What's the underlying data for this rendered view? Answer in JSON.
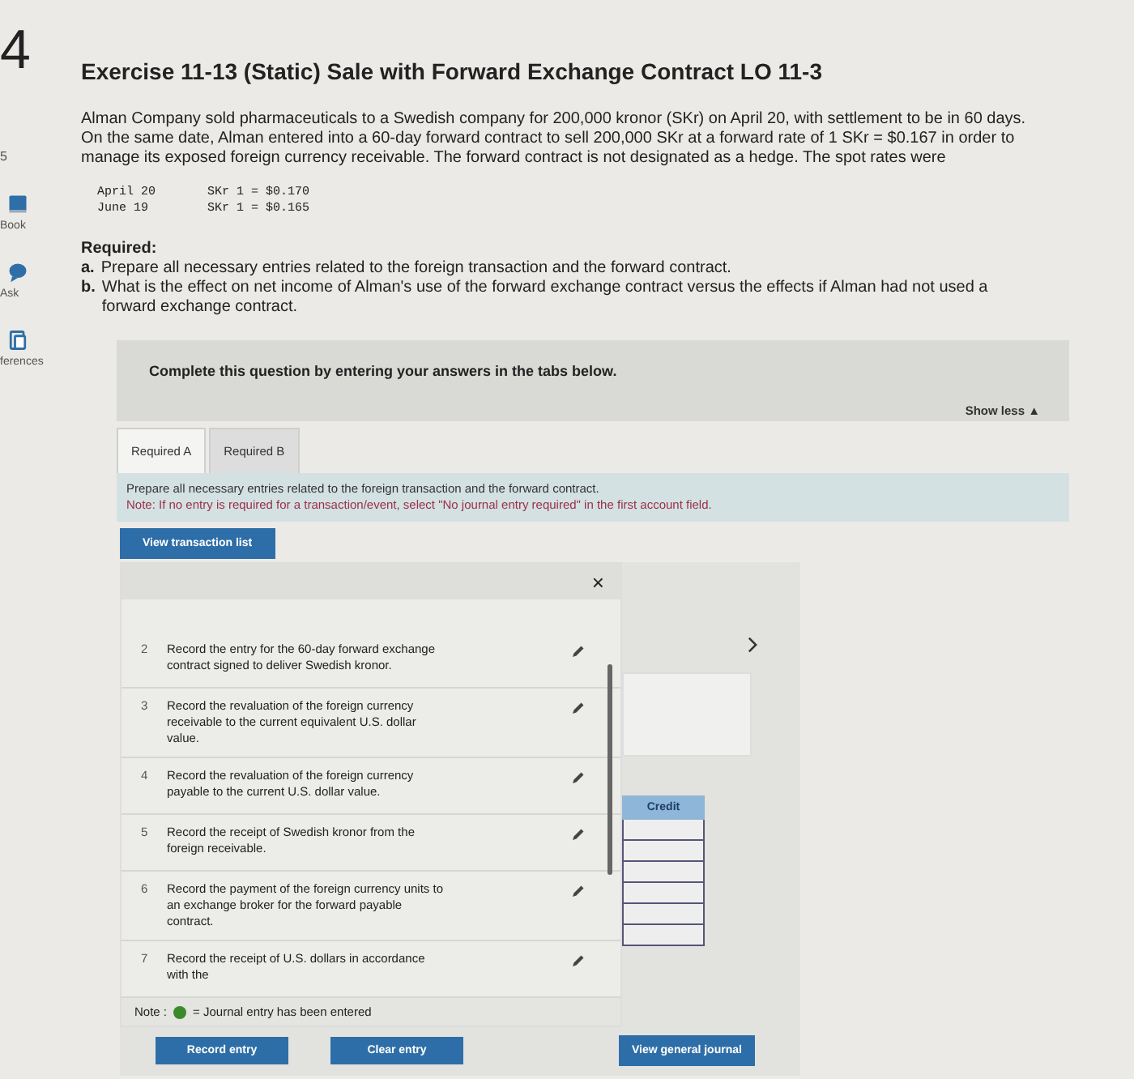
{
  "sidebar": {
    "number": "4",
    "side_mark": "5",
    "items": [
      {
        "label": "Book",
        "kind": "book"
      },
      {
        "label": "Ask",
        "kind": "ask"
      },
      {
        "label": "ferences",
        "kind": "references"
      }
    ]
  },
  "title": "Exercise 11-13 (Static) Sale with Forward Exchange Contract LO 11-3",
  "paragraph": "Alman Company sold pharmaceuticals to a Swedish company for 200,000 kronor (SKr) on April 20, with settlement to be in 60 days. On the same date, Alman entered into a 60-day forward contract to sell 200,000 SKr at a forward rate of 1 SKr = $0.167 in order to manage its exposed foreign currency receivable. The forward contract is not designated as a hedge. The spot rates were",
  "rates": [
    {
      "date": "April 20",
      "rate": "SKr 1 = $0.170"
    },
    {
      "date": "June 19",
      "rate": "SKr 1 = $0.165"
    }
  ],
  "required": {
    "heading": "Required:",
    "items": [
      {
        "letter": "a.",
        "text": "Prepare all necessary entries related to the foreign transaction and the forward contract."
      },
      {
        "letter": "b.",
        "text": "What is the effect on net income of Alman's use of the forward exchange contract versus the effects if Alman had not used a forward exchange contract."
      }
    ]
  },
  "question_box": {
    "prompt": "Complete this question by entering your answers in the tabs below.",
    "toggle": "Show less ▲"
  },
  "tabs": [
    {
      "label": "Required A",
      "selected": true
    },
    {
      "label": "Required B",
      "selected": false
    }
  ],
  "instructions": {
    "text": "Prepare all necessary entries related to the foreign transaction and the forward contract.",
    "note": "Note: If no entry is required for a transaction/event, select \"No journal entry required\" in the first account field."
  },
  "view_list_button": "View transaction list",
  "transaction_list": {
    "close": "×",
    "items": [
      {
        "number": "2",
        "text": "Record the entry for the 60-day forward exchange contract signed to deliver Swedish kronor."
      },
      {
        "number": "3",
        "text": "Record the revaluation of the foreign currency receivable to the current equivalent U.S. dollar value."
      },
      {
        "number": "4",
        "text": "Record the revaluation of the foreign currency payable to the current U.S. dollar value."
      },
      {
        "number": "5",
        "text": "Record the receipt of Swedish kronor from the foreign receivable."
      },
      {
        "number": "6",
        "text": "Record the payment of the foreign currency units to an exchange broker for the forward payable contract."
      },
      {
        "number": "7",
        "text": "Record the receipt of U.S. dollars in accordance with the"
      }
    ]
  },
  "note": {
    "prefix": "Note :",
    "text": "= Journal entry has been entered"
  },
  "journal": {
    "column": "Credit"
  },
  "buttons": [
    {
      "label": "Record entry"
    },
    {
      "label": "Clear entry"
    }
  ],
  "journal_button": "View general journal"
}
